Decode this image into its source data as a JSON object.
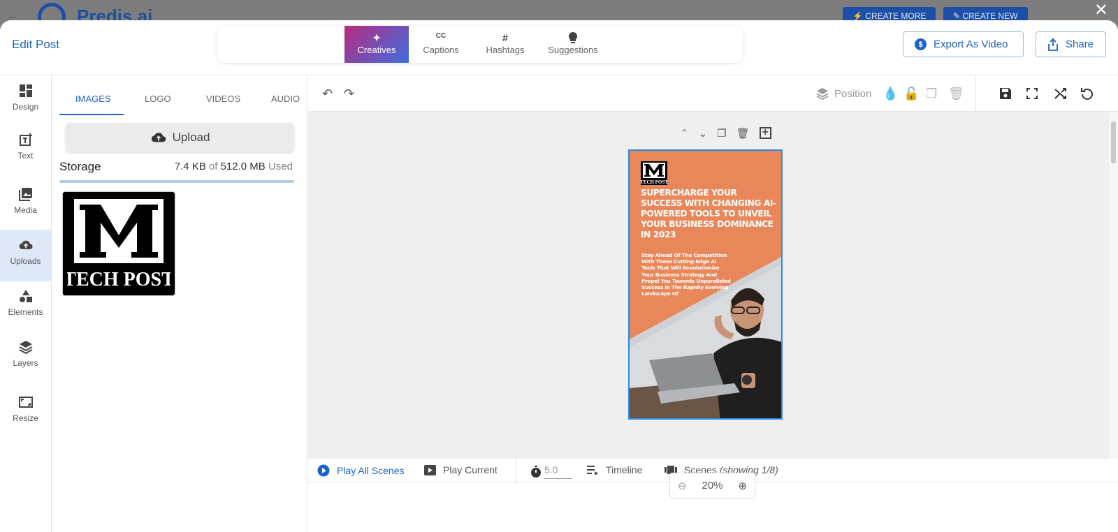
{
  "background_app": {
    "brand": "Predis.ai",
    "create_more": "CREATE MORE",
    "create_new": "CREATE NEW"
  },
  "close_symbol": "✕",
  "header": {
    "title": "Edit Post",
    "tabs": [
      {
        "label": "Creatives",
        "icon": "magic-wand-icon",
        "glyph": "✦"
      },
      {
        "label": "Captions",
        "icon": "closed-captions-icon",
        "glyph": "CC"
      },
      {
        "label": "Hashtags",
        "icon": "hashtag-icon",
        "glyph": "#"
      },
      {
        "label": "Suggestions",
        "icon": "lightbulb-icon",
        "glyph": "💡"
      }
    ],
    "export_label": "Export As Video",
    "share_label": "Share"
  },
  "rail": {
    "items": [
      {
        "label": "Design",
        "icon": "dashboard-icon"
      },
      {
        "label": "Text",
        "icon": "add-text-icon"
      },
      {
        "label": "Media",
        "icon": "media-icon"
      },
      {
        "label": "Uploads",
        "icon": "cloud-upload-icon"
      },
      {
        "label": "Elements",
        "icon": "shapes-icon"
      },
      {
        "label": "Layers",
        "icon": "layers-icon"
      },
      {
        "label": "Resize",
        "icon": "resize-icon"
      }
    ],
    "active": "Uploads"
  },
  "panel": {
    "tabs": [
      "IMAGES",
      "LOGO",
      "VIDEOS",
      "AUDIO"
    ],
    "active_tab": "IMAGES",
    "upload_label": "Upload",
    "storage_label": "Storage",
    "storage_used": "7.4 KB",
    "storage_of": "of",
    "storage_total": "512.0 MB",
    "storage_used_word": "Used",
    "thumb_logo_letter": "M",
    "thumb_logo_text": "TECH POST"
  },
  "toolbar": {
    "position_label": "Position"
  },
  "post": {
    "logo_letter": "M",
    "logo_text": "TECH POST",
    "headline": "SUPERCHARGE YOUR SUCCESS WITH CHANGING AI-POWERED TOOLS TO UNVEIL YOUR BUSINESS DOMINANCE IN 2023",
    "body": "Stay Ahead Of The Competition With These Cutting-Edge Ai Tools That Will Revolutionize Your Business Strategy And Propel You Towards Unparalleled Success In The Rapidly Evolving Landscape Of",
    "colors": {
      "orange": "#e8875a",
      "selection": "#2d8be3"
    }
  },
  "bottom": {
    "play_all": "Play All Scenes",
    "play_current": "Play Current",
    "duration": "5.0",
    "timeline": "Timeline",
    "scenes_label": "Scenes",
    "scenes_count": "(showing 1/8)",
    "zoom": "20%"
  },
  "accent_color": "#1d63c4"
}
